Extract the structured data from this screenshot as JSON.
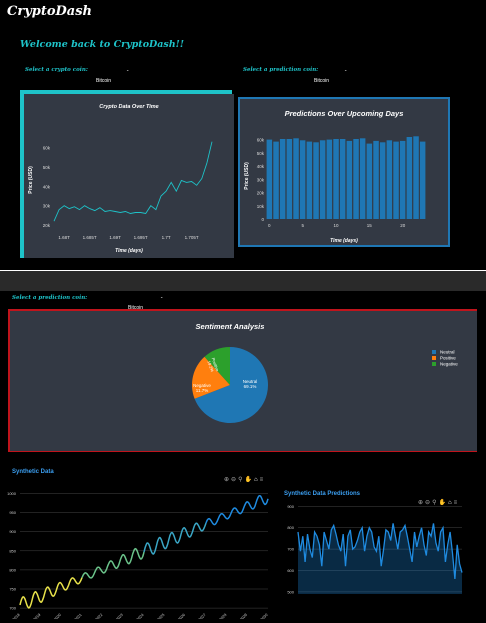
{
  "app": {
    "title": "CryptoDash",
    "welcome": "Welcome back to CryptoDash!!"
  },
  "controls": {
    "crypto_label": "Select a crypto coin:",
    "crypto_value": "Bitcoin",
    "prediction_label": "Select a prediction coin:",
    "prediction_value": "Bitcoin",
    "prediction2_label": "Select a prediction coin:",
    "prediction2_value": "Bitcoin"
  },
  "colors": {
    "cyan": "#1ec3c9",
    "blue": "#1f77b4",
    "orange": "#ff7f0e",
    "green": "#2ca02c",
    "red": "#c0141c",
    "panel": "#333944"
  },
  "icons": [
    "zoom-in-icon",
    "zoom-out-icon",
    "zoom-icon",
    "pan-icon",
    "home-icon",
    "menu-icon"
  ],
  "chart_data": [
    {
      "type": "line",
      "title": "Crypto Data Over Time",
      "xlabel": "Time (days)",
      "ylabel": "Price (USD)",
      "x_ticks": [
        "1.68T",
        "1.685T",
        "1.69T",
        "1.695T",
        "1.7T",
        "1.705T"
      ],
      "y_ticks": [
        "20k",
        "30k",
        "40k",
        "50k",
        "60k"
      ],
      "ylim": [
        18000,
        68000
      ],
      "x": [
        1.678,
        1.679,
        1.68,
        1.681,
        1.682,
        1.683,
        1.684,
        1.685,
        1.686,
        1.687,
        1.688,
        1.689,
        1.69,
        1.691,
        1.692,
        1.693,
        1.694,
        1.695,
        1.696,
        1.697,
        1.698,
        1.699,
        1.7,
        1.701,
        1.702,
        1.703,
        1.704,
        1.705,
        1.706,
        1.707,
        1.708,
        1.709
      ],
      "y": [
        22000,
        28000,
        30000,
        28500,
        29500,
        28000,
        30000,
        28500,
        27500,
        29000,
        27000,
        27500,
        27000,
        26500,
        27000,
        26000,
        26500,
        26500,
        26000,
        30000,
        28000,
        35000,
        37500,
        42000,
        37500,
        43000,
        42000,
        42500,
        40500,
        44000,
        52000,
        63000
      ],
      "color": "#1ec3c9"
    },
    {
      "type": "bar",
      "title": "Predictions Over Upcoming Days",
      "xlabel": "Time (days)",
      "ylabel": "Price (USD)",
      "x_ticks": [
        "0",
        "5",
        "10",
        "15",
        "20"
      ],
      "y_ticks": [
        "0",
        "10k",
        "20k",
        "30k",
        "40k",
        "50k",
        "60k"
      ],
      "ylim": [
        0,
        65000
      ],
      "categories": [
        0,
        1,
        2,
        3,
        4,
        5,
        6,
        7,
        8,
        9,
        10,
        11,
        12,
        13,
        14,
        15,
        16,
        17,
        18,
        19,
        20,
        21,
        22,
        23
      ],
      "values": [
        60000,
        58500,
        60500,
        60500,
        61000,
        59500,
        58500,
        58000,
        59500,
        60000,
        60500,
        60500,
        59000,
        60500,
        61000,
        57000,
        59000,
        58000,
        59500,
        58500,
        59000,
        62000,
        62500,
        58500
      ],
      "color": "#1f77b4"
    },
    {
      "type": "pie",
      "title": "Sentiment Analysis",
      "labels": [
        "Neutral",
        "Positive",
        "Negative"
      ],
      "values": [
        69.1,
        19.2,
        11.7
      ],
      "slice_labels": [
        "Neutral 69.1%",
        "Positive 19.2%",
        "Negative 11.7%"
      ],
      "colors": [
        "#1f77b4",
        "#ff7f0e",
        "#2ca02c"
      ],
      "legend": "top-right"
    },
    {
      "type": "line",
      "title": "Synthetic Data",
      "y_ticks": [
        "700",
        "750",
        "800",
        "850",
        "900",
        "950",
        "1000"
      ],
      "x_ticks": [
        "2018",
        "2019",
        "2020",
        "2021",
        "2022",
        "2023",
        "2024",
        "2025",
        "2026",
        "2027",
        "2028",
        "2029",
        "2030"
      ],
      "ylim": [
        695,
        1025
      ],
      "trend_start": 708,
      "trend_end": 990,
      "cycles": 20,
      "amplitude": 14,
      "colorscale": [
        "#e8e24a",
        "#6bc38a",
        "#3aa6c5",
        "#1f8be0"
      ]
    },
    {
      "type": "area",
      "title": "Synthetic Data Predictions",
      "y_ticks": [
        "500",
        "600",
        "700",
        "800",
        "900"
      ],
      "ylim": [
        490,
        920
      ],
      "values": [
        780,
        690,
        760,
        640,
        770,
        700,
        660,
        780,
        760,
        720,
        620,
        780,
        740,
        700,
        790,
        810,
        770,
        720,
        690,
        770,
        620,
        760,
        790,
        700,
        710,
        740,
        780,
        800,
        690,
        760,
        800,
        780,
        710,
        690,
        760,
        620,
        700,
        790,
        780,
        740,
        820,
        760,
        700,
        780,
        790,
        810,
        760,
        700,
        640,
        780,
        710,
        760,
        800,
        720,
        670,
        780,
        760,
        820,
        730,
        690,
        780,
        800,
        640,
        720,
        780,
        680,
        560,
        720,
        630,
        590
      ],
      "color": "#1f8be0"
    }
  ]
}
